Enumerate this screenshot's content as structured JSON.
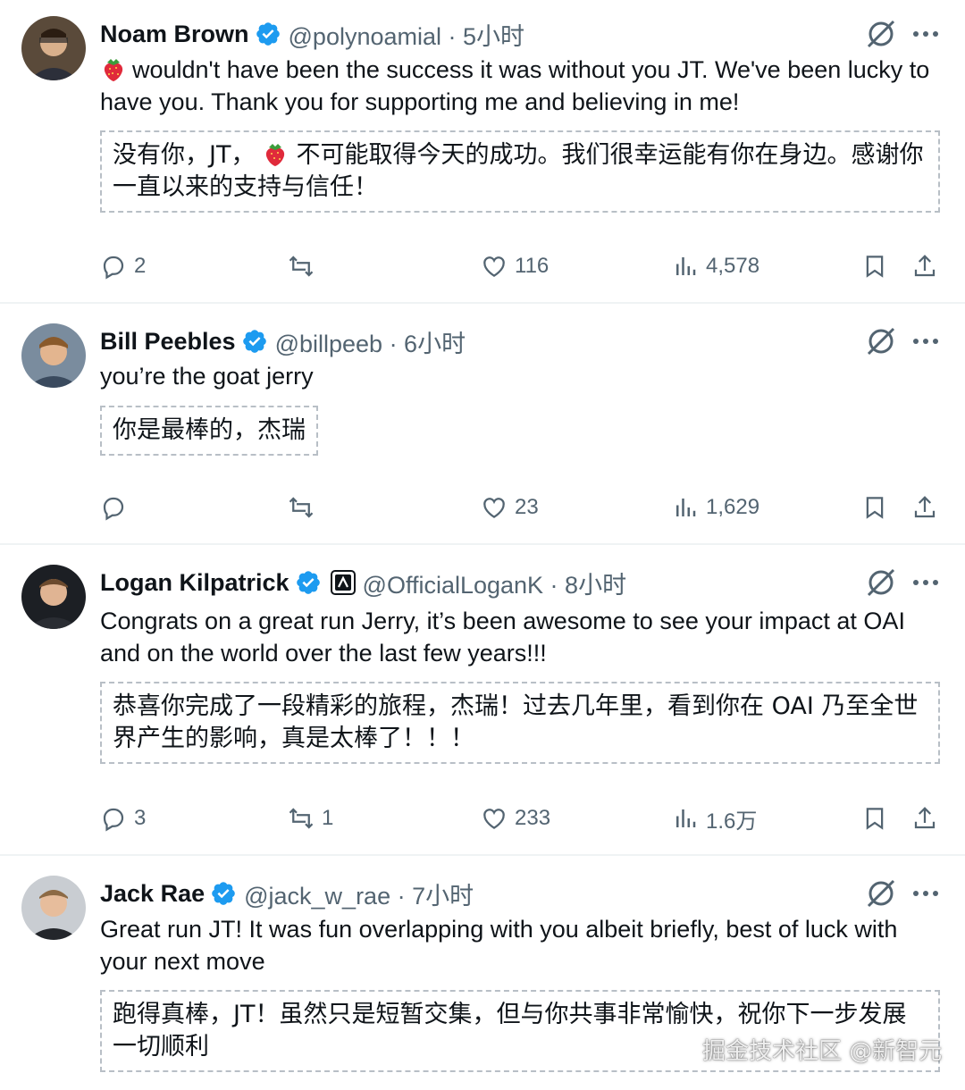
{
  "colors": {
    "text": "#0f1419",
    "muted": "#536471",
    "verified": "#1d9bf0",
    "divider": "#eff3f4"
  },
  "tweets": [
    {
      "name": "Noam Brown",
      "handle": "@polynoamial · 5小时",
      "text_emoji": "strawberry",
      "text": "wouldn't have been the success it was without you JT. We've been lucky to have you. Thank you for supporting me and believing in me!",
      "translation_pre": "没有你，JT，",
      "translation_emoji": "strawberry",
      "translation_post": "不可能取得今天的成功。我们很幸运能有你在身边。感谢你一直以来的支持与信任！",
      "stats": {
        "replies": "2",
        "retweets": "",
        "likes": "116",
        "views": "4,578"
      }
    },
    {
      "name": "Bill Peebles",
      "handle": "@billpeeb · 6小时",
      "text": "you’re the goat jerry",
      "translation": "你是最棒的，杰瑞",
      "stats": {
        "replies": "",
        "retweets": "",
        "likes": "23",
        "views": "1,629"
      }
    },
    {
      "name": "Logan Kilpatrick",
      "handle": "@OfficialLoganK · 8小时",
      "text": "Congrats on a great run Jerry, it’s been awesome to see your impact at OAI and on the world over the last few years!!!",
      "translation": "恭喜你完成了一段精彩的旅程，杰瑞！过去几年里，看到你在 OAI 乃至全世界产生的影响，真是太棒了！！！",
      "stats": {
        "replies": "3",
        "retweets": "1",
        "likes": "233",
        "views": "1.6万"
      }
    },
    {
      "name": "Jack Rae",
      "handle": "@jack_w_rae · 7小时",
      "text": "Great run JT! It was fun overlapping with you albeit briefly, best of luck with your next move",
      "translation": "跑得真棒，JT！虽然只是短暂交集，但与你共事非常愉快，祝你下一步发展一切顺利"
    }
  ],
  "watermark": "掘金技术社区 @新智元"
}
